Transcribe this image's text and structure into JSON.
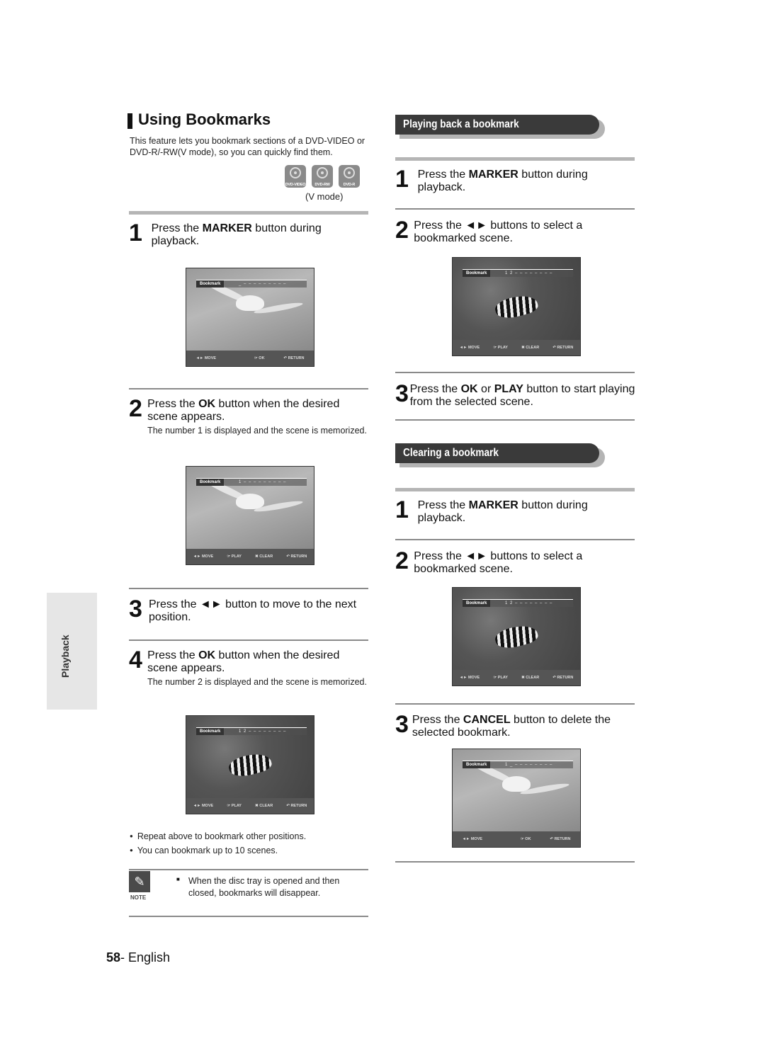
{
  "left": {
    "title": "Using Bookmarks",
    "intro": "This feature lets you bookmark sections of a DVD-VIDEO or DVD-R/-RW(V mode), so you can quickly find them.",
    "discs": [
      "DVD-VIDEO",
      "DVD-RW",
      "DVD-R"
    ],
    "vmode": "(V mode)",
    "steps": [
      {
        "num": "1",
        "pre": "Press the ",
        "bold": "MARKER",
        "post": " button during playback.",
        "sub": ""
      },
      {
        "num": "2",
        "pre": "Press the ",
        "bold": "OK",
        "post": " button when the desired scene appears.",
        "sub": "The number 1 is displayed and the scene is memorized."
      },
      {
        "num": "3",
        "pre": "Press the ",
        "bold": "◄►",
        "post": " button to move to the next position.",
        "sub": ""
      },
      {
        "num": "4",
        "pre": "Press the ",
        "bold": "OK",
        "post": " button when the desired scene appears.",
        "sub": "The number 2 is displayed and the scene is memorized."
      }
    ],
    "bullets": [
      "Repeat above to bookmark other positions.",
      "You can bookmark up to 10 scenes."
    ],
    "note": {
      "label": "NOTE",
      "text": "When the disc tray is opened and then closed, bookmarks will disappear."
    }
  },
  "screens": {
    "s1": {
      "tag": "Bookmark",
      "marks": "_ – – – – – – – – –",
      "buttons": [
        "◄► MOVE",
        "☞ OK",
        "↶ RETURN"
      ]
    },
    "s2": {
      "tag": "Bookmark",
      "marks": "1 – – – – – – – – –",
      "buttons": [
        "◄► MOVE",
        "☞ PLAY",
        "✖ CLEAR",
        "↶ RETURN"
      ]
    },
    "s3": {
      "tag": "Bookmark",
      "marks": "1 2 – – – – – – – –",
      "buttons": [
        "◄► MOVE",
        "☞ PLAY",
        "✖ CLEAR",
        "↶ RETURN"
      ]
    },
    "s4": {
      "tag": "Bookmark",
      "marks": "1 2 – – – – – – – –",
      "buttons": [
        "◄► MOVE",
        "☞ PLAY",
        "✖ CLEAR",
        "↶ RETURN"
      ]
    },
    "s5": {
      "tag": "Bookmark",
      "marks": "1 2 – – – – – – – –",
      "buttons": [
        "◄► MOVE",
        "☞ PLAY",
        "✖ CLEAR",
        "↶ RETURN"
      ]
    },
    "s6": {
      "tag": "Bookmark",
      "marks": "1 _ – – – – – – – –",
      "buttons": [
        "◄► MOVE",
        "☞ OK",
        "↶ RETURN"
      ]
    }
  },
  "right": {
    "playing": {
      "header": "Playing back a bookmark",
      "steps": [
        {
          "num": "1",
          "pre": "Press the ",
          "bold": "MARKER",
          "post": " button during playback."
        },
        {
          "num": "2",
          "pre": "Press the ",
          "bold": "◄►",
          "post": " buttons to select a bookmarked scene."
        },
        {
          "num": "3",
          "pre": "Press the ",
          "bold": "OK",
          "mid": " or ",
          "bold2": "PLAY",
          "post": " button to start playing from the selected scene."
        }
      ]
    },
    "clearing": {
      "header": "Clearing a bookmark",
      "steps": [
        {
          "num": "1",
          "pre": "Press the ",
          "bold": "MARKER",
          "post": " button during playback."
        },
        {
          "num": "2",
          "pre": "Press the ",
          "bold": "◄►",
          "post": " buttons to select a bookmarked scene."
        },
        {
          "num": "3",
          "pre": "Press the ",
          "bold": "CANCEL",
          "post": " button to delete the selected bookmark."
        }
      ]
    }
  },
  "side_tab": "Playback",
  "footer": {
    "page": "58",
    "lang": "- English"
  }
}
